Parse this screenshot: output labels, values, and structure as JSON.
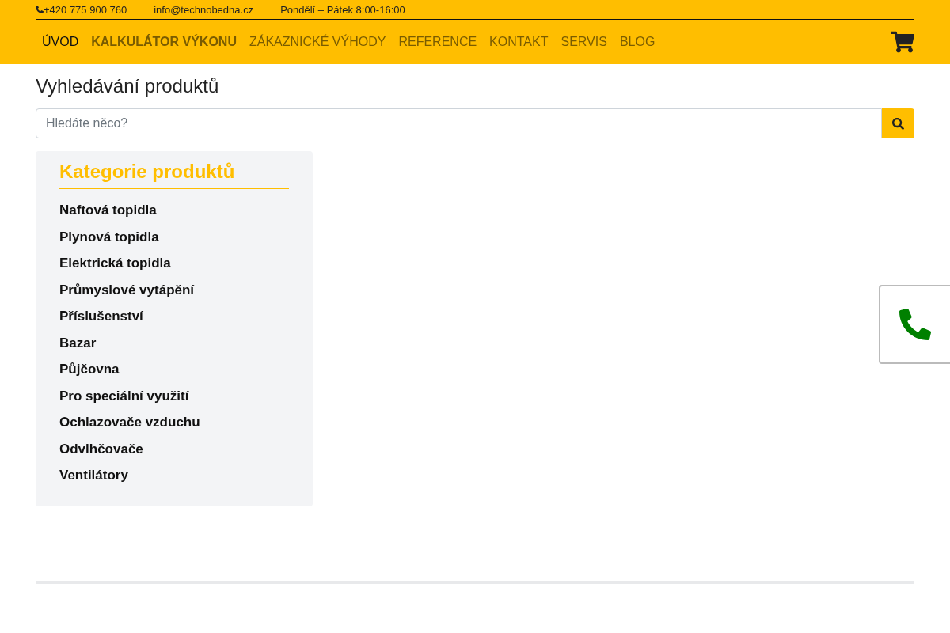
{
  "topbar": {
    "phone": "+420 775 900 760",
    "email": "info@technobedna.cz",
    "hours": "Pondělí – Pátek 8:00-16:00"
  },
  "nav": [
    {
      "label": "ÚVOD",
      "selected": true,
      "bold": false
    },
    {
      "label": "KALKULÁTOR VÝKONU",
      "selected": false,
      "bold": true
    },
    {
      "label": "ZÁKAZNICKÉ VÝHODY",
      "selected": false,
      "bold": false
    },
    {
      "label": "REFERENCE",
      "selected": false,
      "bold": false
    },
    {
      "label": "KONTAKT",
      "selected": false,
      "bold": false
    },
    {
      "label": "SERVIS",
      "selected": false,
      "bold": false
    },
    {
      "label": "BLOG",
      "selected": false,
      "bold": false
    }
  ],
  "page_title": "Vyhledávání produktů",
  "search": {
    "placeholder": "Hledáte něco?"
  },
  "sidebar": {
    "title": "Kategorie produktů",
    "items": [
      "Naftová topidla",
      "Plynová topidla",
      "Elektrická topidla",
      "Průmyslové vytápění",
      "Příslušenství",
      "Bazar",
      "Půjčovna",
      "Pro speciální využití",
      "Ochlazovače vzduchu",
      "Odvlhčovače",
      "Ventilátory"
    ]
  }
}
